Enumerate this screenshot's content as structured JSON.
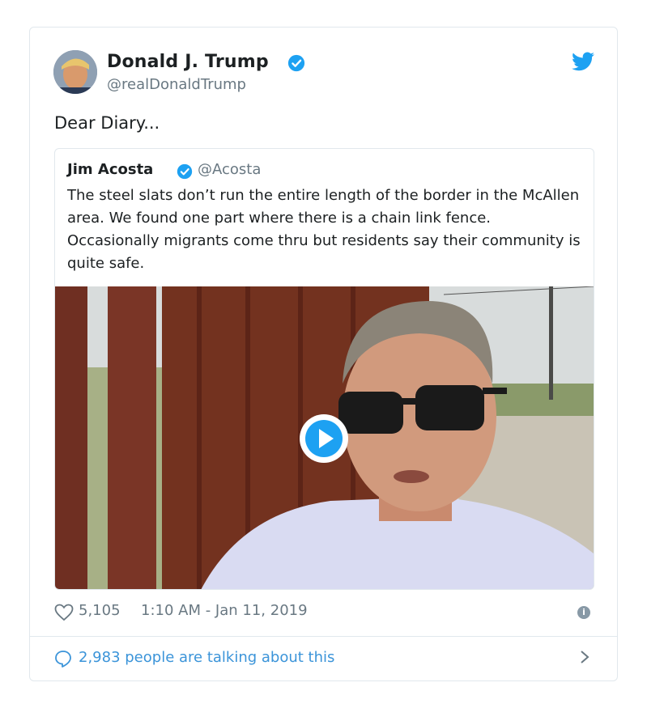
{
  "tweet": {
    "author_name": "Donald J. Trump",
    "author_handle": "@realDonaldTrump",
    "text": "Dear Diary...",
    "likes": "5,105",
    "timestamp": "1:10 AM - Jan 11, 2019",
    "talking": "2,983 people are talking about this"
  },
  "quoted": {
    "author_name": "Jim Acosta",
    "author_handle": "@Acosta",
    "text": "The steel slats don’t run the entire length of the border in the McAllen area. We found one part where there is a chain link fence. Occasionally migrants come thru but residents say their community is quite safe."
  },
  "icons": {
    "verified": "verified-badge-icon",
    "bird": "twitter-bird-icon",
    "heart": "heart-icon",
    "info": "info-icon",
    "talk": "speech-bubble-icon",
    "chevron": "chevron-right-icon",
    "play": "play-icon"
  },
  "colors": {
    "accent": "#1da1f2",
    "link": "#3b94d9",
    "muted": "#697882",
    "border": "#e1e8ed"
  }
}
